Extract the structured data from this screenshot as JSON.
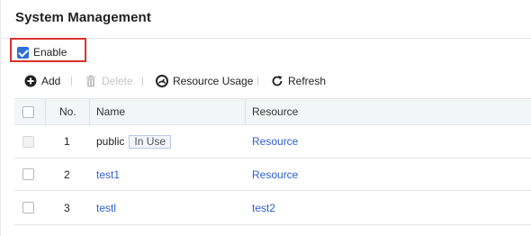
{
  "title": "System Management",
  "enable": {
    "label": "Enable",
    "checked": true
  },
  "toolbar": {
    "add": "Add",
    "delete": "Delete",
    "resource_usage": "Resource Usage",
    "refresh": "Refresh"
  },
  "table": {
    "headers": {
      "no": "No.",
      "name": "Name",
      "resource": "Resource"
    },
    "rows": [
      {
        "no": "1",
        "name": "public",
        "tag": "In Use",
        "resource": "Resource",
        "checkbox_disabled": true
      },
      {
        "no": "2",
        "name": "test1",
        "tag": "",
        "resource": "Resource",
        "checkbox_disabled": false
      },
      {
        "no": "3",
        "name": "testl",
        "tag": "",
        "resource": "test2",
        "checkbox_disabled": false
      }
    ]
  },
  "colors": {
    "accent": "#2f6fd6",
    "link": "#2f5fd1",
    "highlight": "#d9322b"
  }
}
